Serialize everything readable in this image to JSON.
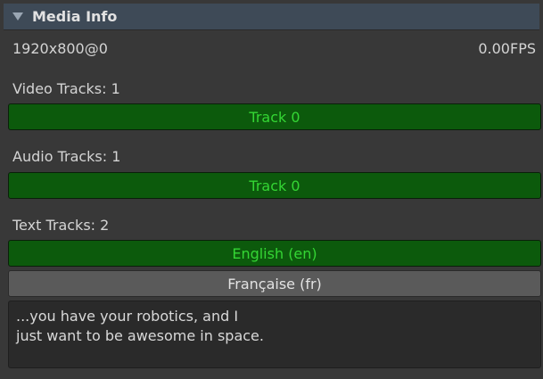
{
  "header": {
    "title": "Media Info",
    "icon": "foldout-arrow-down"
  },
  "media": {
    "resolution": "1920x800@0",
    "fps": "0.00FPS"
  },
  "video": {
    "label": "Video Tracks: 1",
    "tracks": [
      "Track 0"
    ]
  },
  "audio": {
    "label": "Audio Tracks: 1",
    "tracks": [
      "Track 0"
    ]
  },
  "text": {
    "label": "Text Tracks: 2",
    "tracks": [
      "English (en)",
      "Française (fr)"
    ]
  },
  "subtitle": {
    "lines": [
      "...you have your robotics, and I",
      "just want to be awesome in space."
    ]
  },
  "colors": {
    "active_track_bg": "#0c5a0c",
    "active_track_text": "#34d634",
    "inactive_track_bg": "#5a5a5a",
    "header_bg": "#3e4a57"
  }
}
